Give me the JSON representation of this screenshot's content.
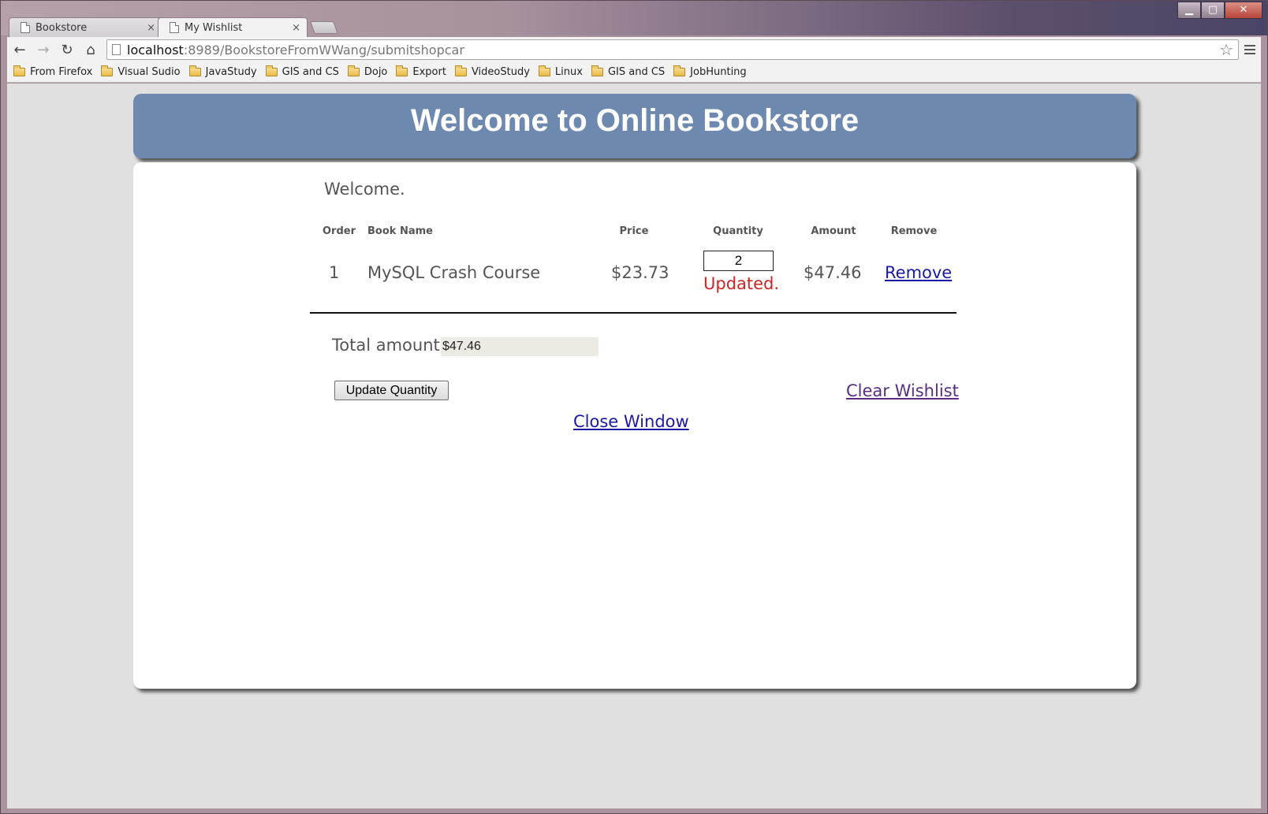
{
  "browser": {
    "tabs": [
      {
        "title": "Bookstore",
        "active": false
      },
      {
        "title": "My Wishlist",
        "active": true
      }
    ],
    "tab_close_glyph": "×",
    "url": {
      "host": "localhost",
      "rest": ":8989/BookstoreFromWWang/submitshopcar"
    },
    "bookmarks": [
      "From Firefox",
      "Visual Sudio",
      "JavaStudy",
      "GIS and CS",
      "Dojo",
      "Export",
      "VideoStudy",
      "Linux",
      "GIS and CS",
      "JobHunting"
    ],
    "icons": {
      "back": "←",
      "forward": "→",
      "reload": "↻",
      "home": "⌂",
      "star": "☆",
      "minimize": "▁",
      "maximize": "▢",
      "close": "✕"
    }
  },
  "page": {
    "header_title": "Welcome to Online Bookstore",
    "welcome_text": "Welcome.",
    "columns": {
      "order": "Order",
      "book_name": "Book Name",
      "price": "Price",
      "quantity": "Quantity",
      "amount": "Amount",
      "remove": "Remove"
    },
    "rows": [
      {
        "order": "1",
        "book_name": "MySQL Crash Course",
        "price": "$23.73",
        "quantity": "2",
        "status": "Updated.",
        "amount": "$47.46",
        "remove_label": "Remove"
      }
    ],
    "total_label": "Total amount:",
    "total_value": "$47.46",
    "update_button": "Update Quantity",
    "clear_link": "Clear Wishlist",
    "close_link": "Close Window",
    "colors": {
      "header_bg": "#6e89b0",
      "status_red": "#d02323",
      "link_blue": "#1a1aa6",
      "visited_purple": "#5a2d84"
    }
  }
}
